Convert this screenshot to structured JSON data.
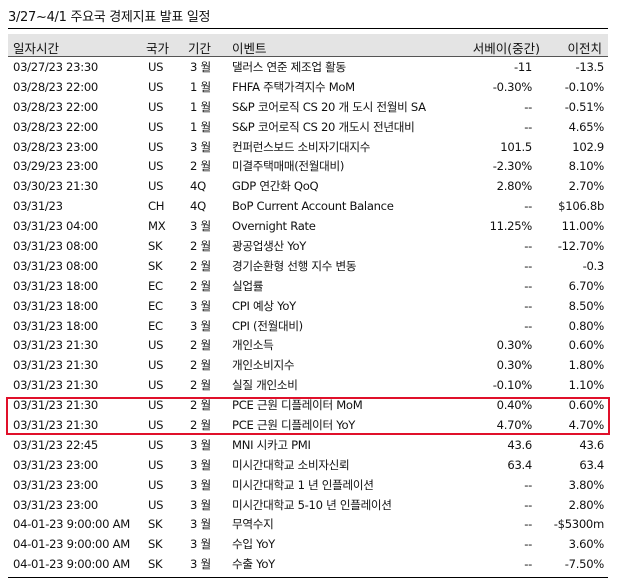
{
  "title": "3/27~4/1 주요국 경제지표 발표 일정",
  "columns": {
    "datetime": "일자시간",
    "country": "국가",
    "period": "기간",
    "event": "이벤트",
    "consensus": "서베이(중간)",
    "previous": "이전치"
  },
  "rows": [
    {
      "datetime": "03/27/23 23:30",
      "country": "US",
      "period": "3 월",
      "event": "댈러스 연준 제조업 활동",
      "consensus": "-11",
      "previous": "-13.5"
    },
    {
      "datetime": "03/28/23 22:00",
      "country": "US",
      "period": "1 월",
      "event": "FHFA 주택가격지수 MoM",
      "consensus": "-0.30%",
      "previous": "-0.10%"
    },
    {
      "datetime": "03/28/23 22:00",
      "country": "US",
      "period": "1 월",
      "event": "S&P 코어로직 CS 20 개 도시 전월비 SA",
      "consensus": "--",
      "previous": "-0.51%"
    },
    {
      "datetime": "03/28/23 22:00",
      "country": "US",
      "period": "1 월",
      "event": "S&P 코어로직 CS 20 개도시 전년대비",
      "consensus": "--",
      "previous": "4.65%"
    },
    {
      "datetime": "03/28/23 23:00",
      "country": "US",
      "period": "3 월",
      "event": "컨퍼런스보드 소비자기대지수",
      "consensus": "101.5",
      "previous": "102.9"
    },
    {
      "datetime": "03/29/23 23:00",
      "country": "US",
      "period": "2 월",
      "event": "미결주택매매(전월대비)",
      "consensus": "-2.30%",
      "previous": "8.10%"
    },
    {
      "datetime": "03/30/23 21:30",
      "country": "US",
      "period": "4Q",
      "event": "GDP 연간화 QoQ",
      "consensus": "2.80%",
      "previous": "2.70%"
    },
    {
      "datetime": "03/31/23",
      "country": "CH",
      "period": "4Q",
      "event": "BoP Current Account Balance",
      "consensus": "--",
      "previous": "$106.8b"
    },
    {
      "datetime": "03/31/23 04:00",
      "country": "MX",
      "period": "3 월",
      "event": "Overnight Rate",
      "consensus": "11.25%",
      "previous": "11.00%"
    },
    {
      "datetime": "03/31/23 08:00",
      "country": "SK",
      "period": "2 월",
      "event": "광공업생산 YoY",
      "consensus": "--",
      "previous": "-12.70%"
    },
    {
      "datetime": "03/31/23 08:00",
      "country": "SK",
      "period": "2 월",
      "event": "경기순환형 선행 지수 변동",
      "consensus": "--",
      "previous": "-0.3"
    },
    {
      "datetime": "03/31/23 18:00",
      "country": "EC",
      "period": "2 월",
      "event": "실업률",
      "consensus": "--",
      "previous": "6.70%"
    },
    {
      "datetime": "03/31/23 18:00",
      "country": "EC",
      "period": "3 월",
      "event": "CPI 예상 YoY",
      "consensus": "--",
      "previous": "8.50%"
    },
    {
      "datetime": "03/31/23 18:00",
      "country": "EC",
      "period": "3 월",
      "event": "CPI (전월대비)",
      "consensus": "--",
      "previous": "0.80%"
    },
    {
      "datetime": "03/31/23 21:30",
      "country": "US",
      "period": "2 월",
      "event": "개인소득",
      "consensus": "0.30%",
      "previous": "0.60%"
    },
    {
      "datetime": "03/31/23 21:30",
      "country": "US",
      "period": "2 월",
      "event": "개인소비지수",
      "consensus": "0.30%",
      "previous": "1.80%"
    },
    {
      "datetime": "03/31/23 21:30",
      "country": "US",
      "period": "2 월",
      "event": "실질 개인소비",
      "consensus": "-0.10%",
      "previous": "1.10%"
    },
    {
      "datetime": "03/31/23 21:30",
      "country": "US",
      "period": "2 월",
      "event": "PCE 근원 디플레이터 MoM",
      "consensus": "0.40%",
      "previous": "0.60%"
    },
    {
      "datetime": "03/31/23 21:30",
      "country": "US",
      "period": "2 월",
      "event": "PCE 근원 디플레이터 YoY",
      "consensus": "4.70%",
      "previous": "4.70%"
    },
    {
      "datetime": "03/31/23 22:45",
      "country": "US",
      "period": "3 월",
      "event": "MNI 시카고 PMI",
      "consensus": "43.6",
      "previous": "43.6"
    },
    {
      "datetime": "03/31/23 23:00",
      "country": "US",
      "period": "3 월",
      "event": "미시간대학교 소비자신뢰",
      "consensus": "63.4",
      "previous": "63.4"
    },
    {
      "datetime": "03/31/23 23:00",
      "country": "US",
      "period": "3 월",
      "event": "미시간대학교 1 년 인플레이션",
      "consensus": "--",
      "previous": "3.80%"
    },
    {
      "datetime": "03/31/23 23:00",
      "country": "US",
      "period": "3 월",
      "event": "미시간대학교 5-10 년 인플레이션",
      "consensus": "--",
      "previous": "2.80%"
    },
    {
      "datetime": "04-01-23  9:00:00 AM",
      "country": "SK",
      "period": "3 월",
      "event": "무역수지",
      "consensus": "--",
      "previous": "-$5300m"
    },
    {
      "datetime": "04-01-23  9:00:00 AM",
      "country": "SK",
      "period": "3 월",
      "event": "수입 YoY",
      "consensus": "--",
      "previous": "3.60%"
    },
    {
      "datetime": "04-01-23  9:00:00 AM",
      "country": "SK",
      "period": "3 월",
      "event": "수출 YoY",
      "consensus": "--",
      "previous": "-7.50%"
    }
  ],
  "highlight": {
    "color": "#e0102a"
  }
}
